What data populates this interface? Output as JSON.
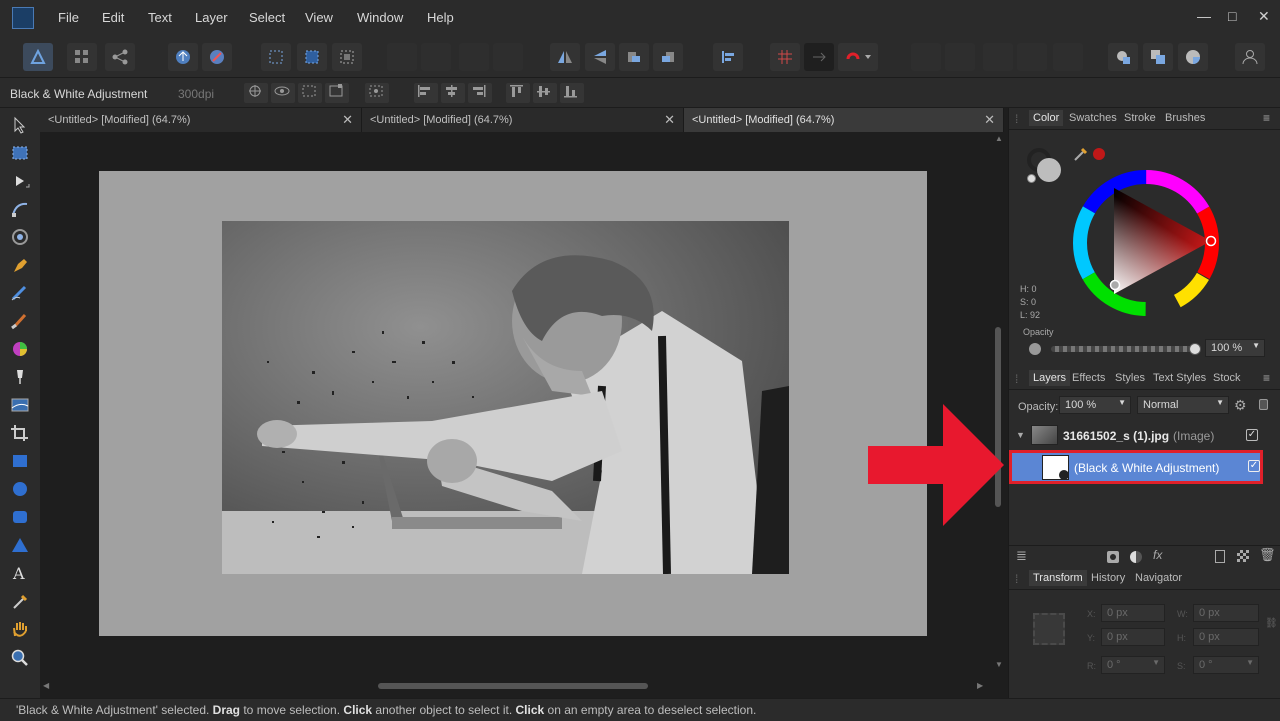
{
  "menu": {
    "items": [
      "File",
      "Edit",
      "Text",
      "Layer",
      "Select",
      "View",
      "Window",
      "Help"
    ],
    "window_controls": [
      "—",
      "□",
      "✕"
    ]
  },
  "context": {
    "title": "Black & White Adjustment",
    "dpi": "300dpi"
  },
  "tabs": [
    {
      "label": "<Untitled> [Modified] (64.7%)",
      "close": "✕"
    },
    {
      "label": "<Untitled> [Modified] (64.7%)",
      "close": "✕"
    },
    {
      "label": "<Untitled> [Modified] (64.7%)",
      "close": "✕"
    }
  ],
  "color_panel": {
    "tabs": [
      "Color",
      "Swatches",
      "Stroke",
      "Brushes"
    ],
    "h": "H: 0",
    "s": "S: 0",
    "l": "L: 92",
    "opacity_label": "Opacity",
    "opacity_value": "100 %",
    "accent_red": "#e0202a"
  },
  "layers_panel": {
    "tabs": [
      "Layers",
      "Effects",
      "Styles",
      "Text Styles",
      "Stock"
    ],
    "opacity_label": "Opacity:",
    "opacity_value": "100 %",
    "blend": "Normal",
    "image_layer": {
      "name": "31661502_s (1).jpg",
      "type": "(Image)"
    },
    "adjustment_layer": {
      "name": "(Black & White Adjustment)"
    },
    "selection_color": "#5b86d4"
  },
  "transform_panel": {
    "tabs": [
      "Transform",
      "History",
      "Navigator"
    ],
    "x_label": "X:",
    "y_label": "Y:",
    "w_label": "W:",
    "h_label": "H:",
    "r_label": "R:",
    "s_label": "S:",
    "x": "0 px",
    "y": "0 px",
    "w": "0 px",
    "h": "0 px",
    "r": "0 °",
    "s": "0 °"
  },
  "status": {
    "part1": "'Black & White Adjustment' selected. ",
    "b1": "Drag",
    "part2": " to move selection. ",
    "b2": "Click",
    "part3": " another object to select it. ",
    "b3": "Click",
    "part4": " on an empty area to deselect selection."
  }
}
